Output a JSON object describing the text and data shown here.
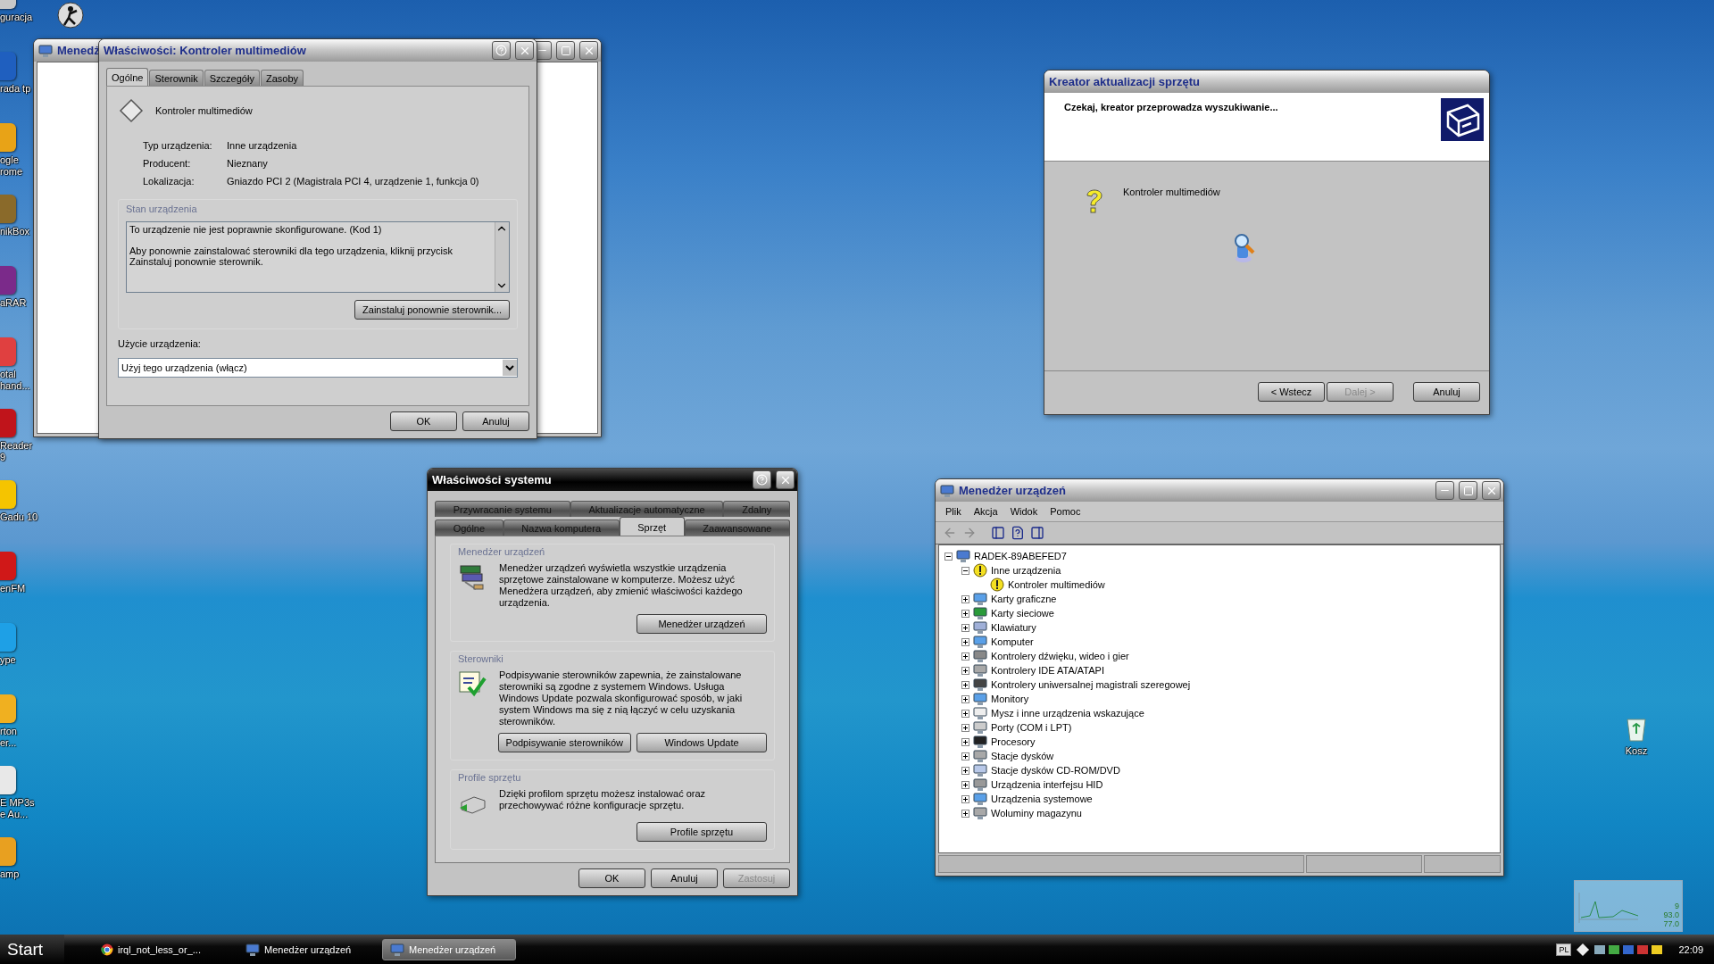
{
  "desktop": {
    "icons": [
      {
        "label": "guracja",
        "color": "#c8c8c8"
      },
      {
        "label": "rada tp",
        "color": "#1f5fbf"
      },
      {
        "label": "ogle\nrome",
        "color": "#e8a317"
      },
      {
        "label": "nikBox",
        "color": "#8a6a2a"
      },
      {
        "label": "aRAR",
        "color": "#7b2a8a"
      },
      {
        "label": "otal\nhand...",
        "color": "#e04040"
      },
      {
        "label": "Reader\n9",
        "color": "#c0141b"
      },
      {
        "label": "Gadu 10",
        "color": "#f5c400"
      },
      {
        "label": "enFM",
        "color": "#d01818"
      },
      {
        "label": "ype",
        "color": "#1ea0e6"
      },
      {
        "label": "rton\ner...",
        "color": "#f0b020"
      },
      {
        "label": "E MP3s\ne Au...",
        "color": "#e8e8e8"
      },
      {
        "label": "amp",
        "color": "#e8a020"
      }
    ],
    "recycle_bin": {
      "label": "Kosz"
    },
    "gadget": {
      "readings": [
        "9",
        "93.0",
        "77.0"
      ]
    }
  },
  "back_window": {
    "title": "Menedż",
    "active": false
  },
  "properties_dialog": {
    "title": "Właściwości: Kontroler multimediów",
    "active": false,
    "tabs": [
      {
        "label": "Ogólne",
        "selected": true
      },
      {
        "label": "Sterownik",
        "selected": false
      },
      {
        "label": "Szczegóły",
        "selected": false
      },
      {
        "label": "Zasoby",
        "selected": false
      }
    ],
    "device_name": "Kontroler multimediów",
    "fields": [
      {
        "label": "Typ urządzenia:",
        "value": "Inne urządzenia"
      },
      {
        "label": "Producent:",
        "value": "Nieznany"
      },
      {
        "label": "Lokalizacja:",
        "value": "Gniazdo PCI 2 (Magistrala PCI 4, urządzenie 1, funkcja 0)"
      }
    ],
    "status_group": {
      "title": "Stan urządzenia",
      "lines": [
        "To urządzenie nie jest poprawnie skonfigurowane. (Kod 1)",
        "Aby ponownie zainstalować sterowniki dla tego urządzenia, kliknij przycisk Zainstaluj ponownie sterownik."
      ],
      "button": "Zainstaluj ponownie sterownik..."
    },
    "usage": {
      "label": "Użycie urządzenia:",
      "value": "Użyj tego urządzenia (włącz)"
    },
    "buttons": [
      {
        "label": "OK",
        "disabled": false
      },
      {
        "label": "Anuluj",
        "disabled": false
      }
    ]
  },
  "wizard": {
    "title": "Kreator aktualizacji sprzętu",
    "active": false,
    "heading": "Czekaj, kreator przeprowadza wyszukiwanie...",
    "device_name": "Kontroler multimediów",
    "buttons": [
      {
        "label": "< Wstecz",
        "disabled": false
      },
      {
        "label": "Dalej >",
        "disabled": true
      },
      {
        "label": "Anuluj",
        "disabled": false
      }
    ]
  },
  "system_properties": {
    "title": "Właściwości systemu",
    "active": true,
    "tab_rows": [
      {
        "tabs": [
          {
            "label": "Przywracanie systemu",
            "selected": false
          },
          {
            "label": "Aktualizacje automatyczne",
            "selected": false
          },
          {
            "label": "Zdalny",
            "selected": false
          }
        ]
      },
      {
        "tabs": [
          {
            "label": "Ogólne",
            "selected": false
          },
          {
            "label": "Nazwa komputera",
            "selected": false
          },
          {
            "label": "Sprzęt",
            "selected": true
          },
          {
            "label": "Zaawansowane",
            "selected": false
          }
        ]
      }
    ],
    "sections": [
      {
        "kind": "devices",
        "title": "Menedżer urządzeń",
        "text": "Menedżer urządzeń wyświetla wszystkie urządzenia sprzętowe zainstalowane w komputerze. Możesz użyć Menedżera urządzeń, aby zmienić właściwości każdego urządzenia.",
        "buttons": [
          "Menedżer urządzeń"
        ]
      },
      {
        "kind": "drivers",
        "title": "Sterowniki",
        "text": "Podpisywanie sterowników zapewnia, że zainstalowane sterowniki są zgodne z systemem Windows. Usługa Windows Update pozwala skonfigurować sposób, w jaki system Windows ma się z nią łączyć w celu uzyskania sterowników.",
        "buttons": [
          "Podpisywanie sterowników",
          "Windows Update"
        ]
      },
      {
        "kind": "profiles",
        "title": "Profile sprzętu",
        "text": "Dzięki profilom sprzętu możesz instalować oraz przechowywać różne konfiguracje sprzętu.",
        "buttons": [
          "Profile sprzętu"
        ]
      }
    ],
    "buttons": [
      {
        "label": "OK",
        "disabled": false
      },
      {
        "label": "Anuluj",
        "disabled": false
      },
      {
        "label": "Zastosuj",
        "disabled": true
      }
    ]
  },
  "device_manager": {
    "title": "Menedżer urządzeń",
    "active": false,
    "menu": [
      "Plik",
      "Akcja",
      "Widok",
      "Pomoc"
    ],
    "toolbar": [
      {
        "kind": "back",
        "disabled": true
      },
      {
        "kind": "forward",
        "disabled": true
      },
      {
        "kind": "tree",
        "disabled": false
      },
      {
        "kind": "properties",
        "disabled": false
      },
      {
        "kind": "panel",
        "disabled": false
      }
    ],
    "tree": {
      "label": "RADEK-89ABEFED7",
      "kind": "computer",
      "expanded": true,
      "children": [
        {
          "label": "Inne urządzenia",
          "kind": "unknown",
          "expanded": true,
          "children": [
            {
              "label": "Kontroler multimediów",
              "kind": "warning"
            }
          ]
        },
        {
          "label": "Karty graficzne",
          "kind": "display",
          "expanded": false
        },
        {
          "label": "Karty sieciowe",
          "kind": "network",
          "expanded": false
        },
        {
          "label": "Klawiatury",
          "kind": "keyboard",
          "expanded": false
        },
        {
          "label": "Komputer",
          "kind": "display",
          "expanded": false
        },
        {
          "label": "Kontrolery dźwięku, wideo i gier",
          "kind": "sound",
          "expanded": false
        },
        {
          "label": "Kontrolery IDE ATA/ATAPI",
          "kind": "disk",
          "expanded": false
        },
        {
          "label": "Kontrolery uniwersalnej magistrali szeregowej",
          "kind": "usb",
          "expanded": false
        },
        {
          "label": "Monitory",
          "kind": "display",
          "expanded": false
        },
        {
          "label": "Mysz i inne urządzenia wskazujące",
          "kind": "mouse",
          "expanded": false
        },
        {
          "label": "Porty (COM i LPT)",
          "kind": "port",
          "expanded": false
        },
        {
          "label": "Procesory",
          "kind": "cpu",
          "expanded": false
        },
        {
          "label": "Stacje dysków",
          "kind": "disk",
          "expanded": false
        },
        {
          "label": "Stacje dysków CD-ROM/DVD",
          "kind": "cdrom",
          "expanded": false
        },
        {
          "label": "Urządzenia interfejsu HID",
          "kind": "hid",
          "expanded": false
        },
        {
          "label": "Urządzenia systemowe",
          "kind": "display",
          "expanded": false
        },
        {
          "label": "Woluminy magazynu",
          "kind": "disk",
          "expanded": false
        }
      ]
    }
  },
  "taskbar": {
    "start": "Start",
    "items": [
      {
        "label": "irql_not_less_or_...",
        "kind": "browser",
        "selected": false
      },
      {
        "label": "Menedżer urządzeń",
        "kind": "devmgr",
        "selected": false
      },
      {
        "label": "Menedżer urządzeń",
        "kind": "devmgr",
        "selected": true
      }
    ],
    "language": "PL",
    "clock": "22:09"
  }
}
